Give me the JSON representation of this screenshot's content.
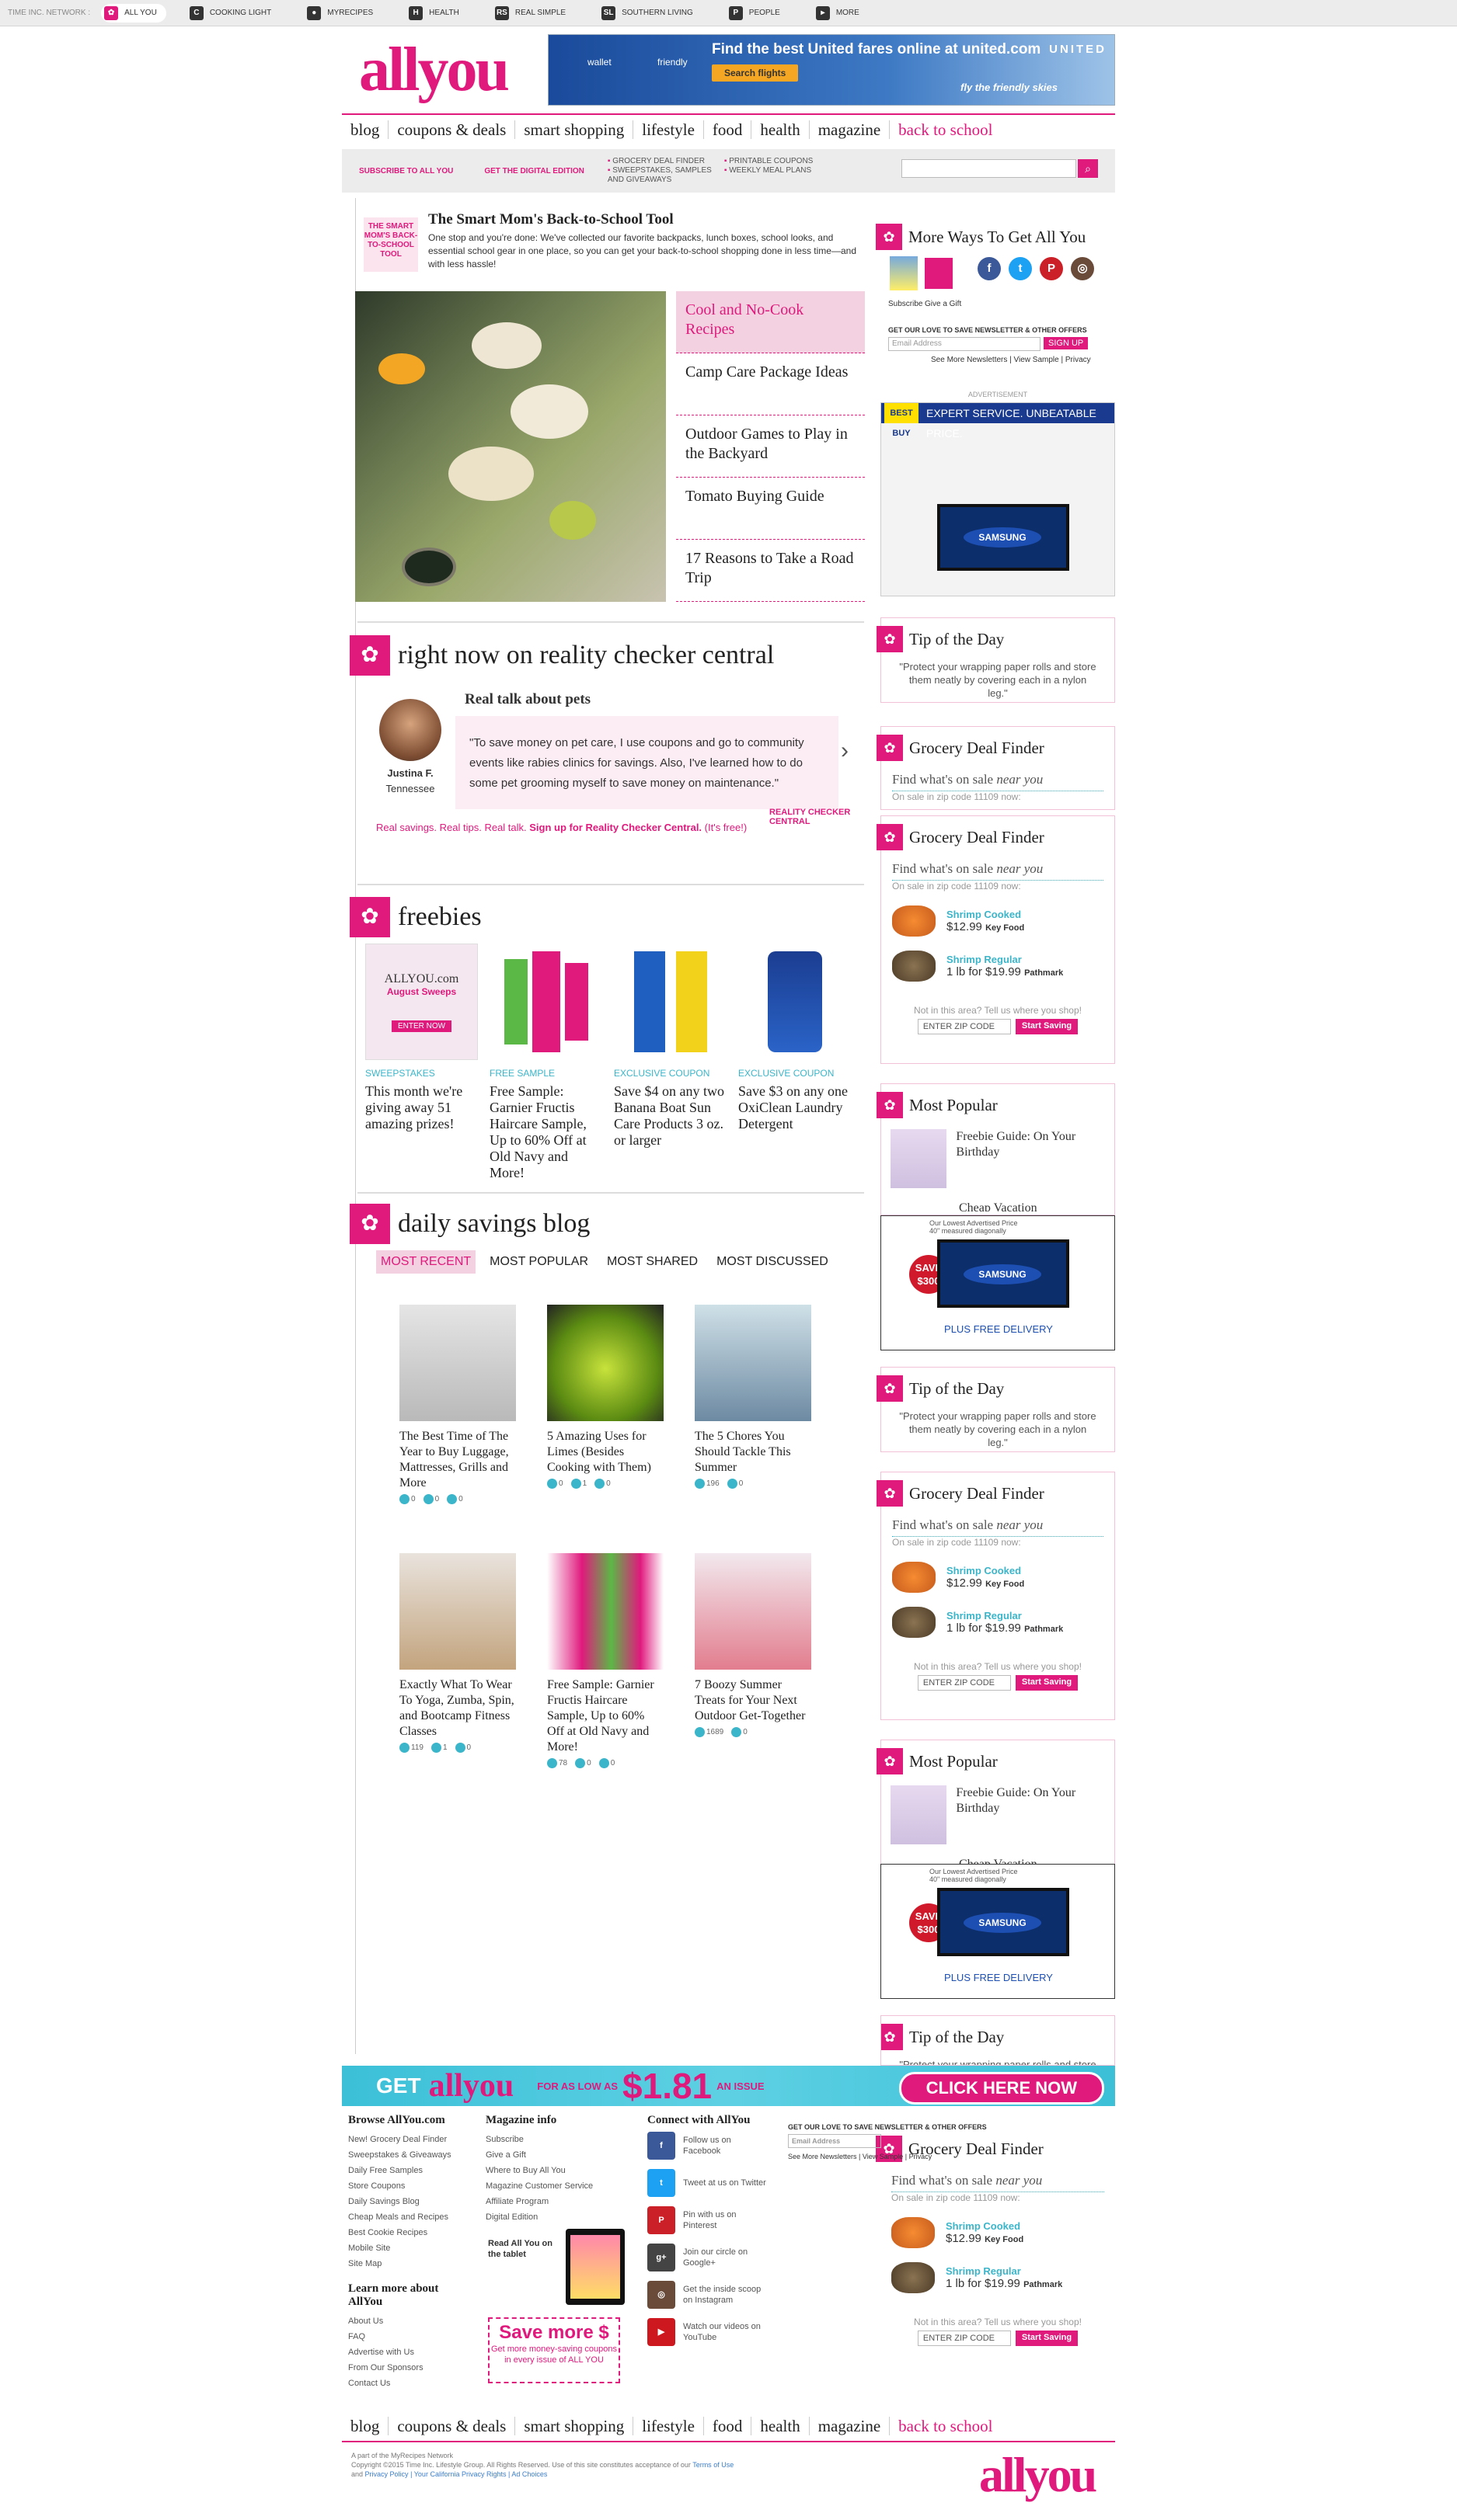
{
  "topbar": {
    "label": "TIME INC. NETWORK :",
    "items": [
      {
        "glyph": "✿",
        "label": "ALL YOU"
      },
      {
        "glyph": "C",
        "label": "COOKING LIGHT"
      },
      {
        "glyph": "●",
        "label": "MYRECIPES"
      },
      {
        "glyph": "H",
        "label": "HEALTH"
      },
      {
        "glyph": "RS",
        "label": "REAL SIMPLE"
      },
      {
        "glyph": "SL",
        "label": "SOUTHERN LIVING"
      },
      {
        "glyph": "P",
        "label": "PEOPLE"
      },
      {
        "glyph": "▸",
        "label": "MORE"
      }
    ]
  },
  "logo": {
    "text1": "all",
    "text2": "you"
  },
  "topad": {
    "headline": "Find the best United fares online at united.com",
    "button": "Search flights",
    "tagline": "fly the friendly skies",
    "brand": "UNITED",
    "w1": "wallet",
    "w2": "friendly"
  },
  "nav": [
    "blog",
    "coupons & deals",
    "smart shopping",
    "lifestyle",
    "food",
    "health",
    "magazine",
    "back to school"
  ],
  "subbar": {
    "subscribe": "SUBSCRIBE TO ALL YOU",
    "digital": "GET THE DIGITAL EDITION",
    "links": [
      "GROCERY DEAL FINDER",
      "PRINTABLE COUPONS",
      "SWEEPSTAKES, SAMPLES AND GIVEAWAYS",
      "WEEKLY MEAL PLANS"
    ]
  },
  "btsp": {
    "icon": "THE SMART MOM'S BACK-TO-SCHOOL TOOL",
    "title": "The Smart Mom's Back-to-School Tool",
    "desc": "One stop and you're done: We've collected our favorite backpacks, lunch boxes, school looks, and essential school gear in one place, so you can get your back-to-school shopping done in less time—and with less hassle!"
  },
  "hero": {
    "items": [
      "Cool and No-Cook Recipes",
      "Camp Care Package Ideas",
      "Outdoor Games to Play in the Backyard",
      "Tomato Buying Guide",
      "17 Reasons to Take a Road Trip"
    ]
  },
  "realitycheck": {
    "heading": "right now on reality checker central",
    "title": "Real talk about pets",
    "quote": "\"To save money on pet care, I use coupons and go to community events like rabies clinics for savings. Also, I've learned how to do some pet grooming myself to save money on maintenance.\"",
    "name": "Justina F.",
    "location": "Tennessee",
    "footer_a": "Real savings. Real tips. Real talk. ",
    "footer_b": "Sign up for Reality Checker Central.",
    "footer_c": " (It's free!)",
    "badge": "REALITY CHECKER CENTRAL"
  },
  "freebies": {
    "heading": "freebies",
    "items": [
      {
        "category": "SWEEPSTAKES",
        "title": "This month we're giving away 51 amazing prizes!",
        "card_title": "ALLYOU.com",
        "card_sub": "August Sweeps",
        "card_cta": "ENTER NOW"
      },
      {
        "category": "FREE SAMPLE",
        "title": "Free Sample: Garnier Fructis Haircare Sample, Up to 60% Off at Old Navy and More!"
      },
      {
        "category": "EXCLUSIVE COUPON",
        "title": "Save $4 on any two Banana Boat Sun Care Products 3 oz. or larger"
      },
      {
        "category": "EXCLUSIVE COUPON",
        "title": "Save $3 on any one OxiClean Laundry Detergent"
      }
    ]
  },
  "blog": {
    "heading": "daily savings blog",
    "tabs": [
      "MOST RECENT",
      "MOST POPULAR",
      "MOST SHARED",
      "MOST DISCUSSED"
    ],
    "posts": [
      {
        "title": "The Best Time of The Year to Buy Luggage, Mattresses, Grills and More",
        "s": [
          "0",
          "0",
          "0"
        ]
      },
      {
        "title": "5 Amazing Uses for Limes (Besides Cooking with Them)",
        "s": [
          "0",
          "1",
          "0"
        ]
      },
      {
        "title": "The 5 Chores You Should Tackle This Summer",
        "s": [
          "196",
          "0",
          ""
        ]
      },
      {
        "title": "Exactly What To Wear To Yoga, Zumba, Spin, and Bootcamp Fitness Classes",
        "s": [
          "119",
          "1",
          "0"
        ]
      },
      {
        "title": "Free Sample: Garnier Fructis Haircare Sample, Up to 60% Off at Old Navy and More!",
        "s": [
          "78",
          "0",
          "0"
        ]
      },
      {
        "title": "7 Boozy Summer Treats for Your Next Outdoor Get-Together",
        "s": [
          "1689",
          "0",
          ""
        ]
      }
    ]
  },
  "sidebar": {
    "more_ways": "More Ways To Get All You",
    "subscribe": "Subscribe",
    "give_gift": "Give a Gift",
    "newsletter_label": "GET OUR LOVE TO SAVE NEWSLETTER & OTHER OFFERS",
    "email_placeholder": "Email Address",
    "signup": "SIGN UP",
    "newsletter_links": "See More Newsletters | View Sample | Privacy",
    "advertisement": "ADVERTISEMENT",
    "bb_logo": "BEST BUY",
    "bb_text": "EXPERT SERVICE. UNBEATABLE PRICE.",
    "tip_title": "Tip of the Day",
    "tip": "\"Protect your wrapping paper rolls and store them neatly by covering each in a nylon leg.\"",
    "gdf_title": "Grocery Deal Finder",
    "gdf_find_a": "Find what's on sale ",
    "gdf_find_b": "near you",
    "gdf_zip": "On sale in zip code 11109 now:",
    "deal1_name": "Shrimp Cooked",
    "deal1_price": "$12.99",
    "deal1_store": "Key Food",
    "deal2_name": "Shrimp Regular",
    "deal2_price": "1 lb for $19.99",
    "deal2_store": "Pathmark",
    "gdf_notarea": "Not in this area? Tell us where you shop!",
    "zip_placeholder": "ENTER ZIP CODE",
    "start_saving": "Start Saving",
    "mp_title": "Most Popular",
    "mp1": "Freebie Guide: On Your Birthday",
    "mp2": "Cheap Vacation",
    "ad_top1": "Our Lowest Advertised Price",
    "ad_top2": "40\" measured diagonally",
    "ad_save": "SAVE $300",
    "ad_free": "PLUS FREE DELIVERY",
    "samsung": "SAMSUNG"
  },
  "promo": {
    "get": "GET",
    "allyou": "allyou",
    "as_low": "FOR AS LOW AS",
    "price": "$1.81",
    "issue": "AN ISSUE",
    "cta": "CLICK HERE NOW"
  },
  "footer": {
    "browse_title": "Browse AllYou.com",
    "browse": [
      "New! Grocery Deal Finder",
      "Sweepstakes & Giveaways",
      "Daily Free Samples",
      "Store Coupons",
      "Daily Savings Blog",
      "Cheap Meals and Recipes",
      "Best Cookie Recipes",
      "Mobile Site",
      "Site Map"
    ],
    "learn_title": "Learn more about AllYou",
    "learn": [
      "About Us",
      "FAQ",
      "Advertise with Us",
      "From Our Sponsors",
      "Contact Us"
    ],
    "mag_title": "Magazine info",
    "mag": [
      "Subscribe",
      "Give a Gift",
      "Where to Buy All You",
      "Magazine Customer Service",
      "Affiliate Program",
      "Digital Edition"
    ],
    "tablet": "Read All You on the tablet",
    "save_more": "Save more $",
    "save_sub": "Get more money-saving coupons in every issue of ALL YOU",
    "connect_title": "Connect with AllYou",
    "social": [
      {
        "g": "f",
        "t": "Follow us on Facebook"
      },
      {
        "g": "t",
        "t": "Tweet at us on Twitter"
      },
      {
        "g": "P",
        "t": "Pin with us on Pinterest"
      },
      {
        "g": "g+",
        "t": "Join our circle on Google+"
      },
      {
        "g": "◎",
        "t": "Get the inside scoop on Instagram"
      },
      {
        "g": "▶",
        "t": "Watch our videos on YouTube"
      }
    ],
    "nl_label": "GET OUR LOVE TO SAVE NEWSLETTER & OTHER OFFERS",
    "nl_email": "Email Address",
    "nl_links": "See More Newsletters | View Sample | Privacy"
  },
  "copyright": {
    "line1": "A part of the MyRecipes Network",
    "line2": "Copyright ©2015 Time Inc. Lifestyle Group. All Rights Reserved. Use of this site constitutes acceptance of our",
    "terms": "Terms of Use",
    "and": "and",
    "privacy": "Privacy Policy",
    "ca": "| Your California Privacy Rights",
    "ad": "| Ad Choices"
  },
  "colors": {
    "brand": "#e0197d",
    "accent": "#3bb5c9"
  }
}
